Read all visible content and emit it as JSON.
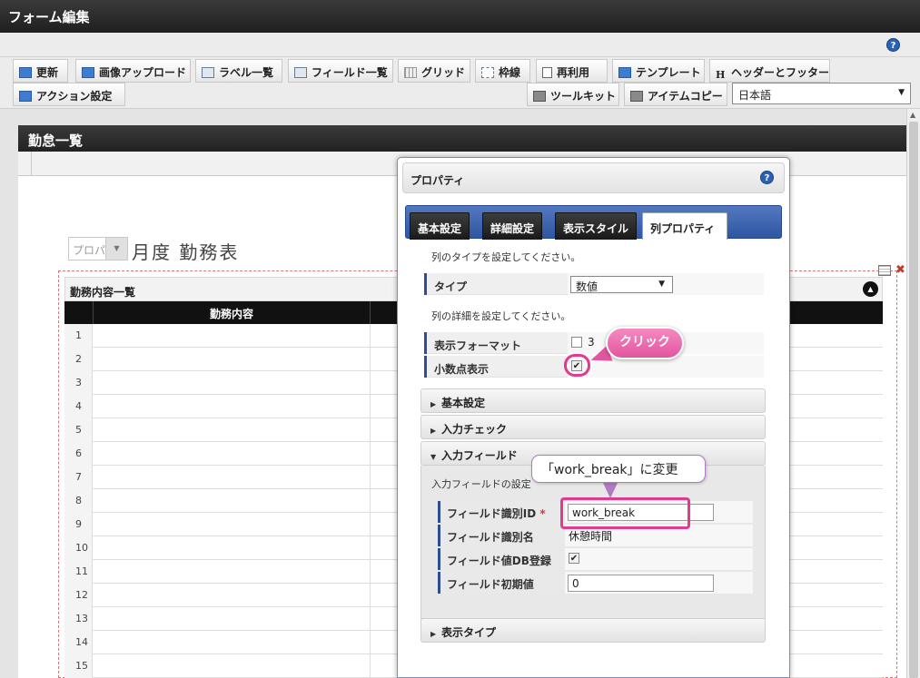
{
  "window": {
    "title": "フォーム編集"
  },
  "help": {
    "glyph": "?"
  },
  "toolbar": {
    "row1": [
      {
        "label": "更新",
        "icon": "refresh-icon"
      },
      {
        "label": "画像アップロード",
        "icon": "image-upload-icon"
      },
      {
        "label": "ラベル一覧",
        "icon": "label-list-icon"
      },
      {
        "label": "フィールド一覧",
        "icon": "field-list-icon"
      },
      {
        "label": "グリッド",
        "icon": "grid-icon"
      },
      {
        "label": "枠線",
        "icon": "border-icon"
      },
      {
        "label": "再利用",
        "icon": "reuse-icon"
      },
      {
        "label": "テンプレート",
        "icon": "template-icon"
      },
      {
        "label": "ヘッダーとフッター",
        "icon": "header-footer-icon"
      }
    ],
    "row2": [
      {
        "label": "アクション設定",
        "icon": "action-icon"
      },
      {
        "label": "ツールキット",
        "icon": "toolkit-icon"
      },
      {
        "label": "アイテムコピー",
        "icon": "item-copy-icon"
      }
    ],
    "language": "日本語"
  },
  "form": {
    "title": "勤怠一覧",
    "month_select_placeholder": "プロパ",
    "month_heading": "月度 勤務表",
    "list": {
      "title": "勤務内容一覧",
      "column": "勤務内容",
      "rows": [
        "1",
        "2",
        "3",
        "4",
        "5",
        "6",
        "7",
        "8",
        "9",
        "10",
        "11",
        "12",
        "13",
        "14",
        "15"
      ]
    }
  },
  "props": {
    "title": "プロパティ",
    "tabs": [
      "基本設定",
      "詳細設定",
      "表示スタイル",
      "列プロパティ"
    ],
    "active_tab": "列プロパティ",
    "type_hint": "列のタイプを設定してください。",
    "type_label": "タイプ",
    "type_value": "数値",
    "detail_hint": "列の詳細を設定してください。",
    "format_label": "表示フォーマット",
    "format_partial": "3",
    "decimal_label": "小数点表示",
    "decimal_checked": true,
    "sections": {
      "basic": "基本設定",
      "input_check": "入力チェック",
      "input_field": "入力フィールド",
      "display_type": "表示タイプ"
    },
    "input_field_hint": "入力フィールドの設定",
    "fields": {
      "id_label": "フィールド識別ID",
      "id_required": "*",
      "id_value": "work_break",
      "name_label": "フィールド識別名",
      "name_value": "休憩時間",
      "db_label": "フィールド値DB登録",
      "db_checked": true,
      "init_label": "フィールド初期値",
      "init_value": "0"
    }
  },
  "annotations": {
    "click": "クリック",
    "rename": "「work_break」に変更"
  },
  "colors": {
    "accent_blue": "#2e56a3",
    "callout_pink": "#e03b91",
    "title_dark": "#222222"
  }
}
